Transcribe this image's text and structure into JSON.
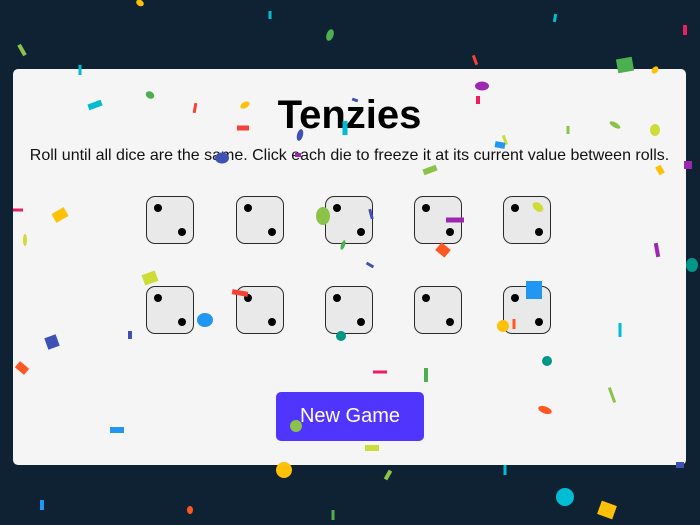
{
  "game": {
    "title": "Tenzies",
    "instructions": "Roll until all dice are the same. Click each die to freeze it at its current value between rolls.",
    "new_game_label": "New Game"
  },
  "dice": [
    {
      "value": 2,
      "held": false
    },
    {
      "value": 2,
      "held": false
    },
    {
      "value": 2,
      "held": false
    },
    {
      "value": 2,
      "held": false
    },
    {
      "value": 2,
      "held": false
    },
    {
      "value": 2,
      "held": false
    },
    {
      "value": 2,
      "held": false
    },
    {
      "value": 2,
      "held": false
    },
    {
      "value": 2,
      "held": false
    },
    {
      "value": 2,
      "held": false
    }
  ],
  "colors": {
    "background": "#0f2233",
    "card": "#f5f5f5",
    "button": "#5035ff",
    "confetti": [
      "#ff5722",
      "#ffc107",
      "#4caf50",
      "#2196f3",
      "#9c27b0",
      "#00bcd4",
      "#8bc34a",
      "#e91e63",
      "#3f51b5",
      "#cddc39",
      "#009688",
      "#f44336"
    ]
  }
}
